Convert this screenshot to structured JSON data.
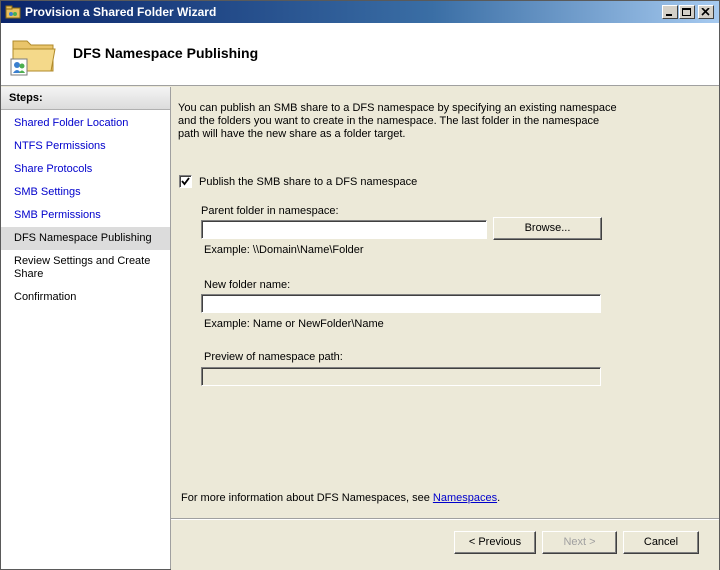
{
  "window": {
    "title": "Provision a Shared Folder Wizard"
  },
  "header": {
    "title": "DFS Namespace Publishing",
    "icon": "shared-folder-icon"
  },
  "steps": {
    "heading": "Steps:",
    "items": [
      {
        "label": "Shared Folder Location",
        "state": "link"
      },
      {
        "label": "NTFS Permissions",
        "state": "link"
      },
      {
        "label": "Share Protocols",
        "state": "link"
      },
      {
        "label": "SMB Settings",
        "state": "link"
      },
      {
        "label": "SMB Permissions",
        "state": "link"
      },
      {
        "label": "DFS Namespace Publishing",
        "state": "current"
      },
      {
        "label": "Review Settings and Create Share",
        "state": "pending"
      },
      {
        "label": "Confirmation",
        "state": "pending"
      }
    ]
  },
  "main": {
    "description": "You can publish an SMB share to a DFS namespace by specifying an existing namespace and the folders you want to create in the namespace. The last folder in the namespace path will have the new share as a folder target.",
    "publish_checkbox_label": "Publish the SMB share to a DFS namespace",
    "publish_checked": true,
    "parent_folder_label": "Parent folder in namespace:",
    "parent_folder_value": "",
    "browse_label": "Browse...",
    "parent_example": "Example: \\\\Domain\\Name\\Folder",
    "new_folder_label": "New folder name:",
    "new_folder_value": "",
    "new_folder_example": "Example: Name or NewFolder\\Name",
    "preview_label": "Preview of namespace path:",
    "preview_value": "",
    "more_info_prefix": "For more information about DFS Namespaces, see ",
    "more_info_link": "Namespaces",
    "more_info_suffix": "."
  },
  "buttons": {
    "previous": "< Previous",
    "next": "Next >",
    "cancel": "Cancel"
  }
}
